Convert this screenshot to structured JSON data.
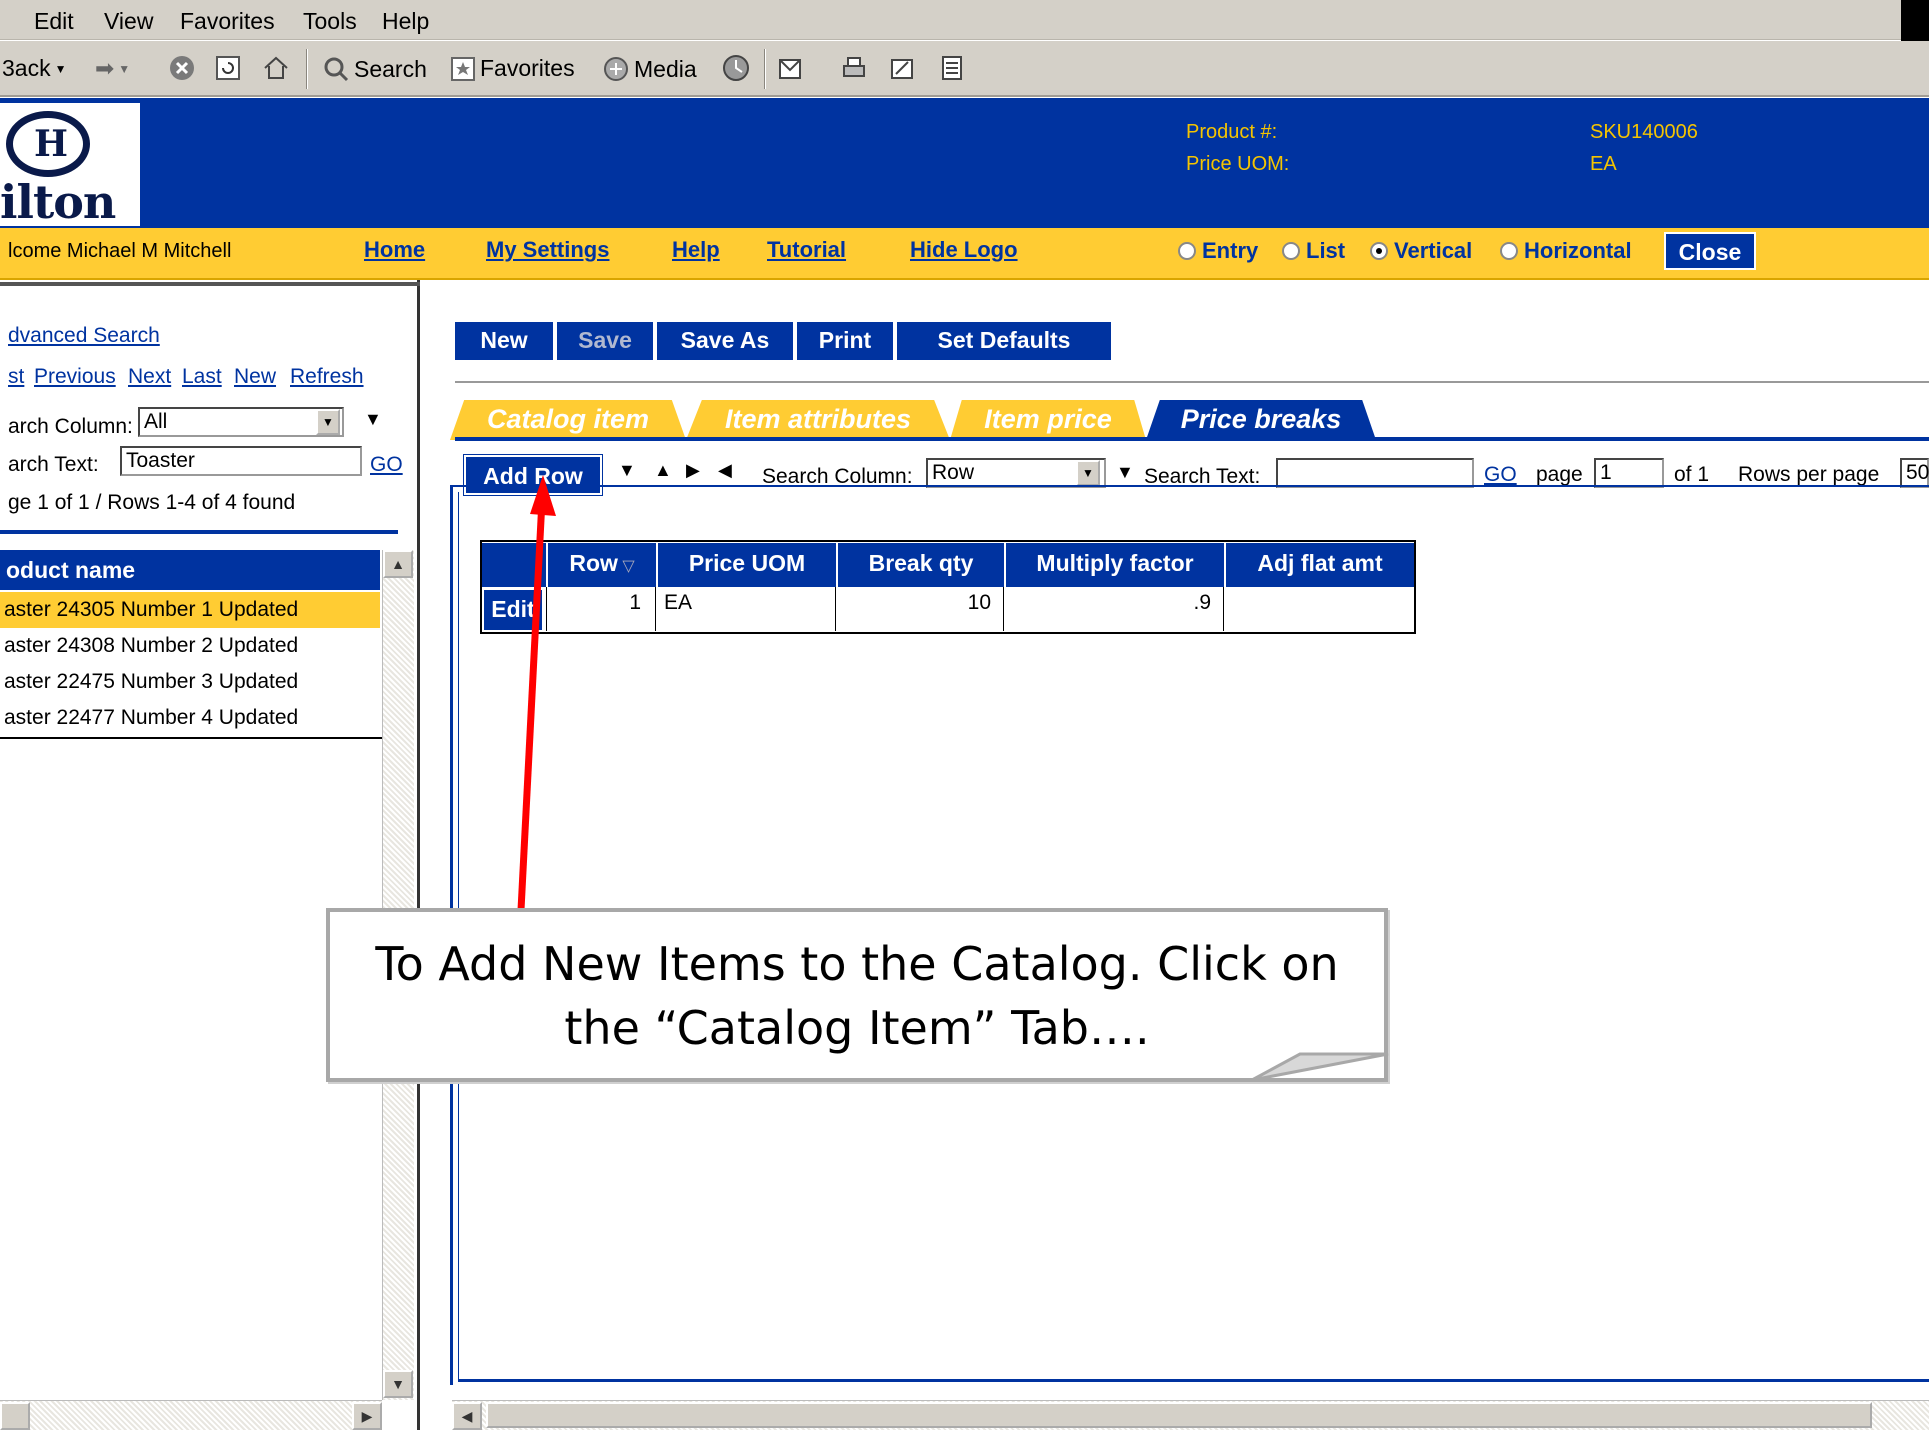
{
  "menu": [
    "Edit",
    "View",
    "Favorites",
    "Tools",
    "Help"
  ],
  "toolbar": {
    "back": "3ack",
    "search": "Search",
    "favorites": "Favorites",
    "media": "Media"
  },
  "header": {
    "logo_name": "ilton",
    "product_label": "Product #:",
    "product_value": "SKU140006",
    "uom_label": "Price UOM:",
    "uom_value": "EA"
  },
  "nav": {
    "welcome": "lcome Michael M Mitchell",
    "links": [
      "Home",
      "My Settings",
      "Help",
      "Tutorial",
      "Hide Logo"
    ],
    "views": [
      {
        "label": "Entry",
        "selected": false
      },
      {
        "label": "List",
        "selected": false
      },
      {
        "label": "Vertical",
        "selected": true
      },
      {
        "label": "Horizontal",
        "selected": false
      }
    ],
    "close": "Close"
  },
  "left": {
    "advanced_search": "dvanced Search",
    "nav_links": [
      "st",
      "Previous",
      "Next",
      "Last",
      "New",
      "Refresh"
    ],
    "search_column_label": "arch Column:",
    "search_column_value": "All",
    "search_text_label": "arch Text:",
    "search_text_value": "Toaster",
    "go": "GO",
    "page_info": "ge 1 of 1 / Rows 1-4 of 4 found",
    "column_header": "oduct name",
    "rows": [
      "aster 24305 Number 1 Updated",
      "aster 24308 Number 2 Updated",
      "aster 22475 Number 3 Updated",
      "aster 22477 Number 4 Updated"
    ]
  },
  "actions": [
    "New",
    "Save",
    "Save As",
    "Print",
    "Set Defaults"
  ],
  "tabs": [
    "Catalog item",
    "Item attributes",
    "Item price",
    "Price breaks"
  ],
  "grid_toolbar": {
    "add_row": "Add Row",
    "search_column_label": "Search Column:",
    "search_column_value": "Row",
    "search_text_label": "Search Text:",
    "search_text_value": "",
    "go": "GO",
    "page_label": "page",
    "page_value": "1",
    "of_label": "of 1",
    "rows_per_page_label": "Rows per page",
    "rows_per_page_value": "50"
  },
  "grid": {
    "headers": [
      "Row",
      "Price UOM",
      "Break qty",
      "Multiply factor",
      "Adj flat amt"
    ],
    "edit": "Edit",
    "row": {
      "row": "1",
      "uom": "EA",
      "qty": "10",
      "factor": ".9",
      "adj": ""
    }
  },
  "callout": {
    "line1": "To Add New Items to the Catalog. Click on",
    "line2": "the “Catalog Item” Tab…."
  },
  "colors": {
    "brand_blue": "#0033a0",
    "brand_yellow": "#ffcc33",
    "arrow_red": "#ff0000"
  }
}
